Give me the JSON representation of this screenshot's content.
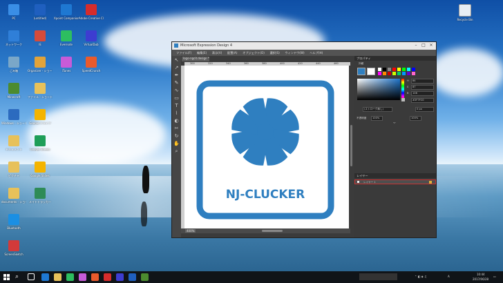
{
  "desktop": {
    "icons": [
      {
        "label": "PC",
        "color": "#3a8ee6"
      },
      {
        "label": "ネットワーク",
        "color": "#2f7fd8"
      },
      {
        "label": "ごみ箱",
        "color": "#7aa7c8"
      },
      {
        "label": "Minecraft",
        "color": "#4c8b2f"
      },
      {
        "label": "Windows - ショートカット",
        "color": "#2c6bbf"
      },
      {
        "label": "ドキュメント",
        "color": "#e7c15a"
      },
      {
        "label": "ピクチャ",
        "color": "#e7c15a"
      },
      {
        "label": "documents - ショートカット",
        "color": "#e7c15a"
      },
      {
        "label": "Bluetooth",
        "color": "#1a8fe3"
      },
      {
        "label": "ScreenSketch",
        "color": "#d23a3a"
      }
    ],
    "icons2": [
      {
        "label": "(untitled)",
        "color": "#1f5fbf"
      },
      {
        "label": "IE",
        "color": "#d54b3a"
      },
      {
        "label": "Organizer - ショートカット",
        "color": "#e1a33a"
      },
      {
        "label": "ファイル - ショートカット",
        "color": "#e7c15a"
      },
      {
        "label": "Google ドライブ",
        "color": "#f4b400"
      },
      {
        "label": "Google Sheets",
        "color": "#1e9e58"
      },
      {
        "label": "Google Slides",
        "color": "#f4b400"
      },
      {
        "label": "メイトトラッカー",
        "color": "#2e8b57"
      }
    ],
    "icons3": [
      {
        "label": "Xpoint Companion",
        "color": "#1e78d2"
      },
      {
        "label": "Evernote",
        "color": "#2dbe60"
      },
      {
        "label": "iTunes",
        "color": "#c75bd8"
      }
    ],
    "icons4": [
      {
        "label": "Adobe Creative Cloud",
        "color": "#d52c2c"
      },
      {
        "label": "VirtualDub",
        "color": "#3d3dd1"
      },
      {
        "label": "SpeedCrunch",
        "color": "#e95a2c"
      }
    ],
    "right_icon": {
      "label": "Recycle Bin",
      "color": "#e8eef4"
    }
  },
  "app": {
    "title": "Microsoft Expression Design 4",
    "menu": [
      "ファイル(F)",
      "編集(E)",
      "表示(V)",
      "配置(A)",
      "オブジェクト(O)",
      "選択(S)",
      "ウィンドウ(W)",
      "ヘルプ(H)"
    ],
    "doc_tab": "logo-ngcit.design *",
    "ruler": [
      "300",
      "320",
      "340",
      "360",
      "380",
      "400",
      "420",
      "440",
      "460",
      "480"
    ],
    "zoom": "400%",
    "logo_text": "NJ-CLUCKER",
    "logo_color": "#2f7fc0"
  },
  "panel": {
    "properties_header": "プロパティ",
    "appearance_label": "外観",
    "hex": "#2F7FC0",
    "h_value": "84",
    "s_value": "87",
    "b_value": "106",
    "stroke_label": "(ストローク無し)",
    "stroke_width": "0 px",
    "opacity_label": "不透明度",
    "opacity_value": "100%",
    "opacity_value2": "100%",
    "layers_header": "レイヤー",
    "layer_name": "レイヤー 1",
    "swatches": [
      "#ffffff",
      "#000000",
      "#888888",
      "#ff0000",
      "#ffff00",
      "#00ff00",
      "#00ffff",
      "#0000ff",
      "#ff00ff",
      "#ff8800",
      "#cc0000",
      "#ccff00",
      "#00cc66",
      "#0099ff",
      "#6600cc",
      "#ff66cc"
    ]
  },
  "taskbar": {
    "time": "10:44",
    "date": "2017/06/28",
    "lang": "A",
    "apps": [
      "#1e78d2",
      "#e7c15a",
      "#2dbe60",
      "#c75bd8",
      "#e95a2c",
      "#d52c2c",
      "#3d3dd1",
      "#1f5fbf",
      "#4c8b2f"
    ]
  }
}
